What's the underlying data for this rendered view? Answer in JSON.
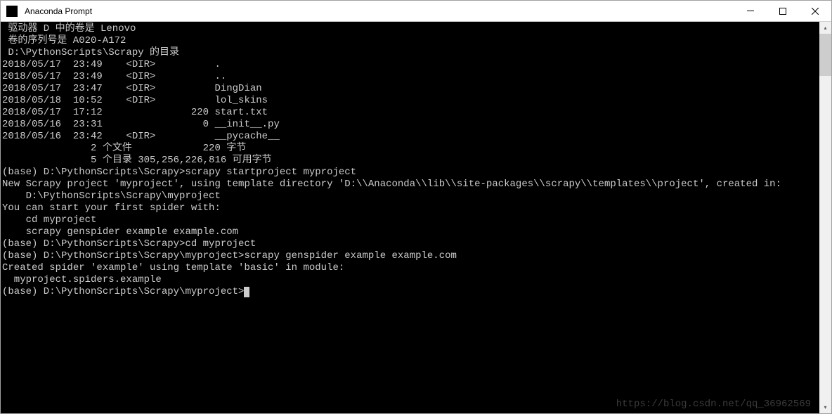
{
  "window": {
    "title": "Anaconda Prompt"
  },
  "terminal": {
    "lines": [
      " 驱动器 D 中的卷是 Lenovo",
      " 卷的序列号是 A020-A172",
      "",
      " D:\\PythonScripts\\Scrapy 的目录",
      "",
      "2018/05/17  23:49    <DIR>          .",
      "2018/05/17  23:49    <DIR>          ..",
      "2018/05/17  23:47    <DIR>          DingDian",
      "2018/05/18  10:52    <DIR>          lol_skins",
      "2018/05/17  17:12               220 start.txt",
      "2018/05/16  23:31                 0 __init__.py",
      "2018/05/16  23:42    <DIR>          __pycache__",
      "               2 个文件            220 字节",
      "               5 个目录 305,256,226,816 可用字节",
      "",
      "(base) D:\\PythonScripts\\Scrapy>scrapy startproject myproject",
      "New Scrapy project 'myproject', using template directory 'D:\\\\Anaconda\\\\lib\\\\site-packages\\\\scrapy\\\\templates\\\\project', created in:",
      "    D:\\PythonScripts\\Scrapy\\myproject",
      "",
      "You can start your first spider with:",
      "    cd myproject",
      "    scrapy genspider example example.com",
      "",
      "(base) D:\\PythonScripts\\Scrapy>cd myproject",
      "",
      "(base) D:\\PythonScripts\\Scrapy\\myproject>scrapy genspider example example.com",
      "Created spider 'example' using template 'basic' in module:",
      "  myproject.spiders.example",
      "",
      "(base) D:\\PythonScripts\\Scrapy\\myproject>"
    ]
  },
  "watermark": "https://blog.csdn.net/qq_36962569"
}
